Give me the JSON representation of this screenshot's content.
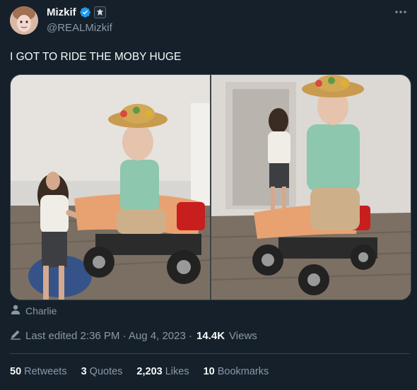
{
  "author": {
    "display_name": "Mizkif",
    "handle": "@REALMizkif",
    "verified_icon": "verified-badge-icon",
    "affiliate_icon": "affiliate-badge-icon"
  },
  "menu_icon": "more-horizontal-icon",
  "tweet": {
    "text": "I GOT TO RIDE THE MOBY HUGE"
  },
  "media": {
    "photos": [
      "photo-1",
      "photo-2"
    ]
  },
  "tagged": {
    "icon": "person-icon",
    "name": "Charlie"
  },
  "edit_info": {
    "icon": "edit-pencil-icon",
    "prefix": "Last edited 2:36 PM · Aug 4, 2023 ·",
    "views_count": "14.4K",
    "views_label": "Views"
  },
  "stats": {
    "retweets": {
      "count": "50",
      "label": "Retweets"
    },
    "quotes": {
      "count": "3",
      "label": "Quotes"
    },
    "likes": {
      "count": "2,203",
      "label": "Likes"
    },
    "bookmarks": {
      "count": "10",
      "label": "Bookmarks"
    }
  },
  "colors": {
    "background": "#15202b",
    "text": "#f7f9f9",
    "secondary": "#8b98a5",
    "verified": "#1d9bf0",
    "border": "#38444d"
  }
}
